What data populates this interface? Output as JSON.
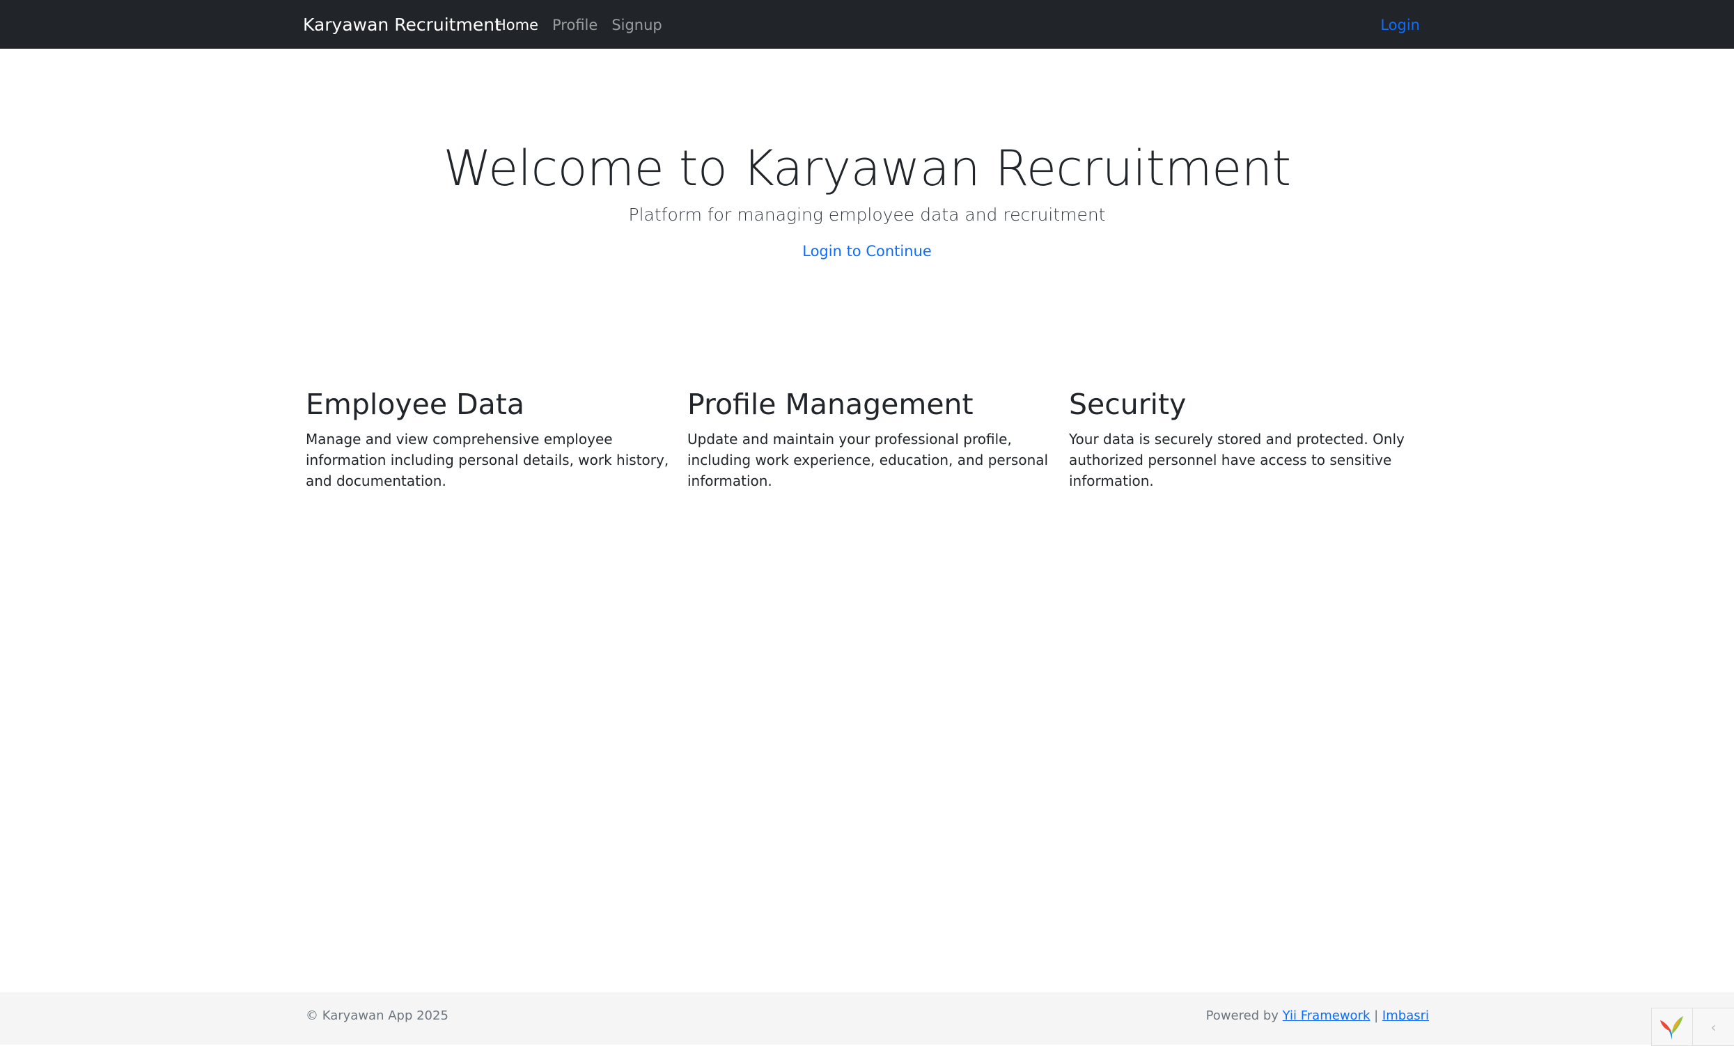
{
  "navbar": {
    "brand": "Karyawan Recruitment",
    "links": [
      {
        "label": "Home",
        "active": true
      },
      {
        "label": "Profile",
        "active": false
      },
      {
        "label": "Signup",
        "active": false
      }
    ],
    "login_label": "Login"
  },
  "hero": {
    "title": "Welcome to Karyawan Recruitment",
    "lead": "Platform for managing employee data and recruitment",
    "cta": "Login to Continue"
  },
  "features": [
    {
      "title": "Employee Data",
      "text": "Manage and view comprehensive employee information including personal details, work history, and documentation."
    },
    {
      "title": "Profile Management",
      "text": "Update and maintain your professional profile, including work experience, education, and personal information."
    },
    {
      "title": "Security",
      "text": "Your data is securely stored and protected. Only authorized personnel have access to sensitive information."
    }
  ],
  "footer": {
    "copyright": "© Karyawan App 2025",
    "powered_by": "Powered by",
    "framework_link": "Yii Framework",
    "separator": "|",
    "author_link": "Imbasri"
  },
  "debug_toolbar": {
    "logo_icon": "yii-logo-icon",
    "toggle_icon": "chevron-left-icon"
  },
  "colors": {
    "navbar_bg": "#212529",
    "link": "#0d6efd",
    "footer_bg": "#f5f5f5"
  }
}
